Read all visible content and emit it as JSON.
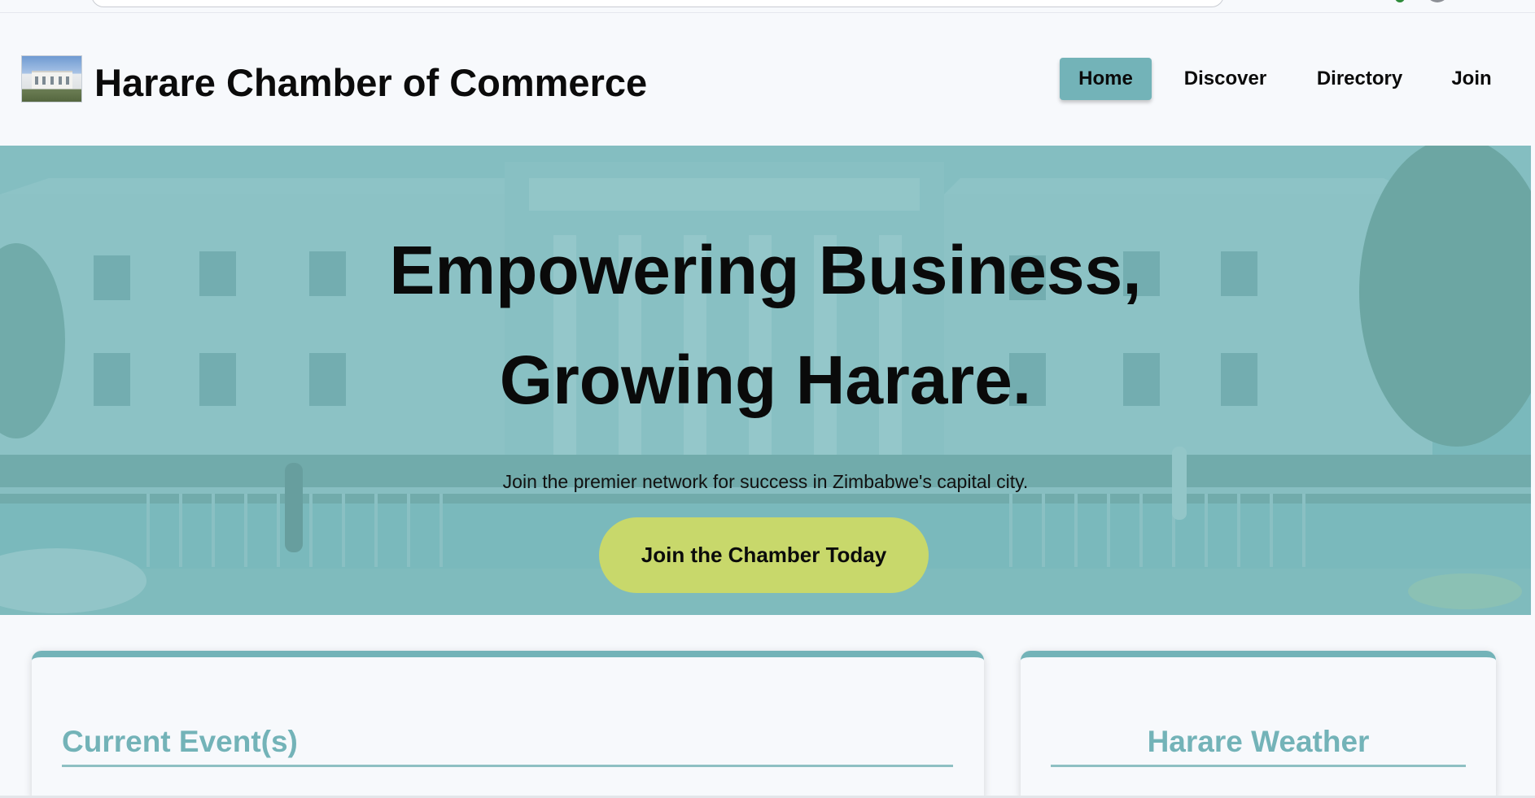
{
  "header": {
    "title": "Harare Chamber of Commerce",
    "nav": [
      {
        "label": "Home",
        "active": true
      },
      {
        "label": "Discover",
        "active": false
      },
      {
        "label": "Directory",
        "active": false
      },
      {
        "label": "Join",
        "active": false
      }
    ]
  },
  "hero": {
    "headline_line1": "Empowering Business,",
    "headline_line2": "Growing Harare.",
    "subtitle": "Join the premier network for success in Zimbabwe's capital city.",
    "cta_label": "Join the Chamber Today"
  },
  "cards": {
    "events_title": "Current Event(s)",
    "weather_title": "Harare Weather"
  },
  "colors": {
    "accent": "#73b3b8",
    "cta": "#c8d86b",
    "background": "#f7f9fc"
  }
}
